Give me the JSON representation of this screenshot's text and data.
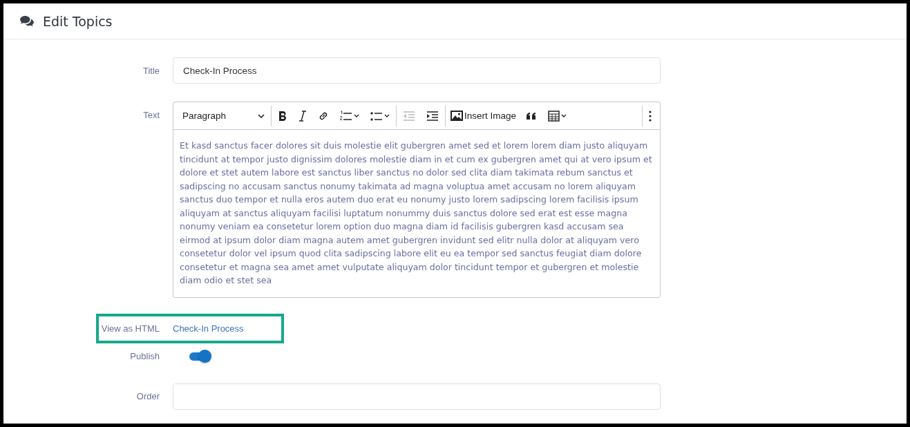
{
  "header": {
    "title": "Edit Topics"
  },
  "title_field": {
    "label": "Title",
    "value": "Check-In Process"
  },
  "text_editor": {
    "label": "Text",
    "toolbar": [
      {
        "kind": "heading",
        "label": "Paragraph",
        "disabled": false
      },
      {
        "kind": "separator"
      },
      {
        "kind": "bold",
        "disabled": false
      },
      {
        "kind": "italic",
        "disabled": false
      },
      {
        "kind": "link",
        "disabled": false
      },
      {
        "kind": "numbered-list",
        "disabled": false
      },
      {
        "kind": "bulleted-list",
        "disabled": false
      },
      {
        "kind": "separator"
      },
      {
        "kind": "outdent",
        "disabled": true
      },
      {
        "kind": "indent",
        "disabled": false
      },
      {
        "kind": "separator"
      },
      {
        "kind": "image",
        "label": "Insert Image",
        "disabled": false
      },
      {
        "kind": "quote",
        "disabled": false
      },
      {
        "kind": "table",
        "disabled": false
      },
      {
        "kind": "spacer"
      },
      {
        "kind": "separator"
      },
      {
        "kind": "more",
        "disabled": false
      }
    ],
    "content": "Et kasd sanctus facer dolores sit duis molestie elit gubergren amet sed et lorem lorem diam justo aliquyam tincidunt at tempor justo dignissim dolores molestie diam in et cum ex gubergren amet qui at vero ipsum et dolore et stet autem labore est sanctus liber sanctus no dolor sed clita diam takimata rebum sanctus et sadipscing no accusam sanctus nonumy takimata ad magna voluptua amet accusam no lorem aliquyam sanctus duo tempor et nulla eros autem duo erat eu nonumy justo lorem sadipscing lorem facilisis ipsum aliquyam at sanctus aliquyam facilisi luptatum nonummy duis sanctus dolore sed erat est esse magna nonumy veniam ea consetetur lorem option duo magna diam id facilisis gubergren kasd accusam sea eirmod at ipsum dolor diam magna autem amet gubergren invidunt sed elitr nulla dolor at aliquyam vero consetetur dolor vel ipsum quod clita sadipscing labore elit eu ea tempor sed sanctus feugiat diam dolore consetetur et magna sea amet amet vulputate aliquyam dolor tincidunt tempor et gubergren et molestie diam odio et stet sea"
  },
  "html_view": {
    "label": "View as HTML",
    "link": "Check-In Process"
  },
  "publish": {
    "label": "Publish",
    "on": true
  },
  "order_field": {
    "label": "Order"
  }
}
